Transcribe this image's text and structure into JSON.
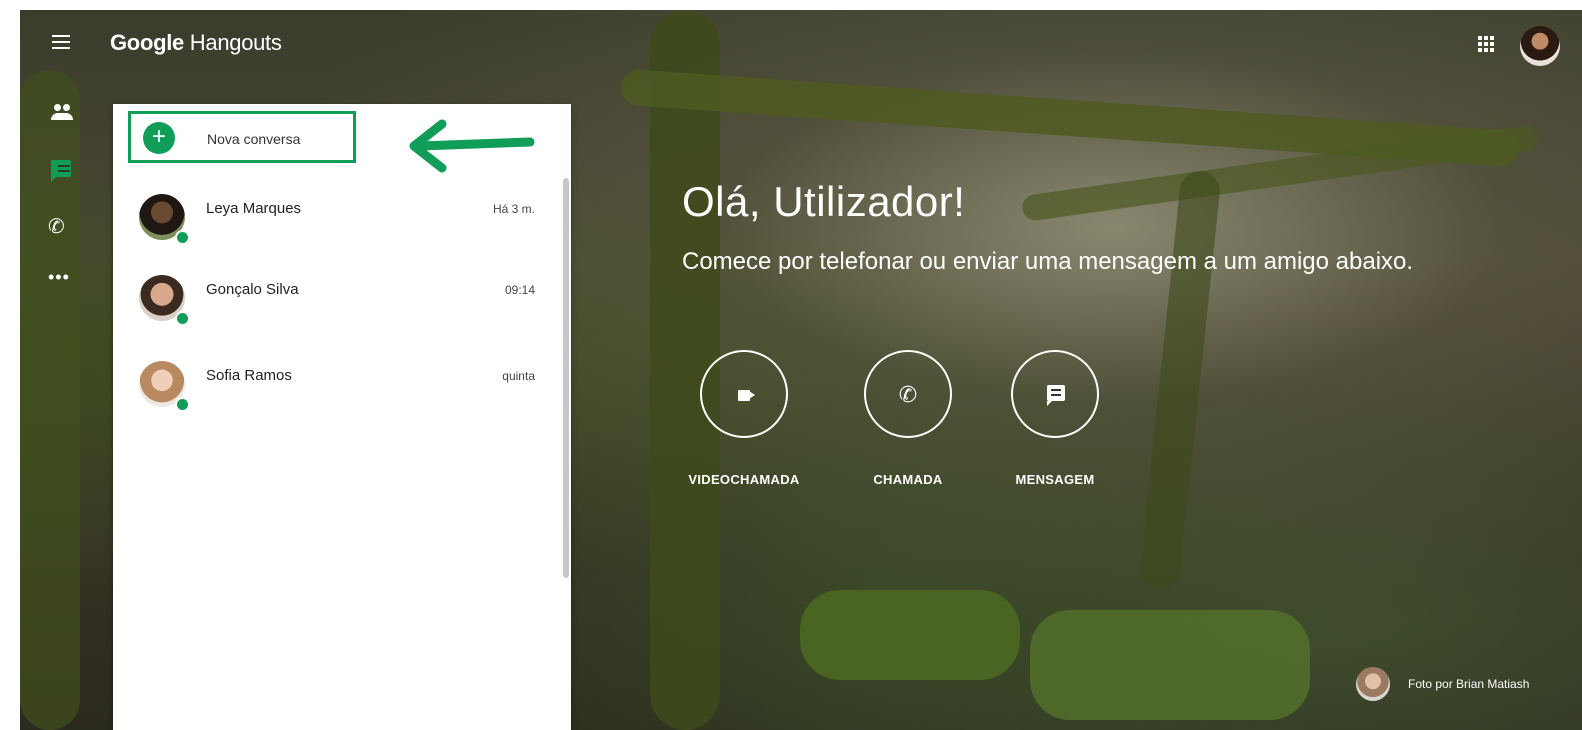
{
  "app": {
    "brand_bold": "Google",
    "brand_rest": "Hangouts"
  },
  "rail": {
    "items": [
      {
        "name": "contacts",
        "icon": "people-icon"
      },
      {
        "name": "conversations",
        "icon": "chat-icon",
        "active": true
      },
      {
        "name": "phone-calls",
        "icon": "phone-icon"
      },
      {
        "name": "more",
        "icon": "more-horiz-icon"
      }
    ]
  },
  "panel": {
    "new_conversation_label": "Nova conversa",
    "conversations": [
      {
        "name": "Leya Marques",
        "time": "Há 3 m.",
        "online": true
      },
      {
        "name": "Gonçalo Silva",
        "time": "09:14",
        "online": true
      },
      {
        "name": "Sofia Ramos",
        "time": "quinta",
        "online": true
      }
    ]
  },
  "main": {
    "greeting": "Olá, Utilizador!",
    "subtitle": "Comece por telefonar ou enviar uma mensagem a um amigo abaixo.",
    "actions": [
      {
        "label": "VIDEOCHAMADA",
        "icon": "videocam-icon"
      },
      {
        "label": "CHAMADA",
        "icon": "phone-icon"
      },
      {
        "label": "MENSAGEM",
        "icon": "message-icon"
      }
    ]
  },
  "credit": {
    "text": "Foto por Brian Matiash"
  },
  "colors": {
    "accent": "#0f9d58",
    "panel_bg": "#ffffff"
  }
}
